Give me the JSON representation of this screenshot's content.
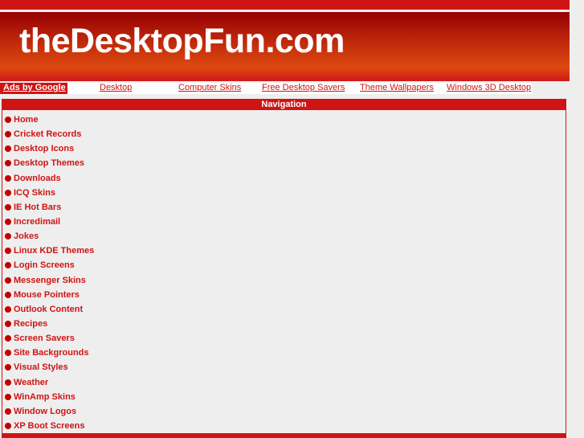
{
  "site_title": "theDesktopFun.com",
  "links": {
    "ads": "Ads by Google",
    "items": [
      "Desktop",
      "Computer Skins",
      "Free Desktop Savers",
      "Theme Wallpapers",
      "Windows 3D Desktop"
    ]
  },
  "nav": {
    "heading": "Navigation",
    "items": [
      "Home",
      "Cricket Records",
      "Desktop Icons",
      "Desktop Themes",
      "Downloads",
      "ICQ Skins",
      "IE Hot Bars",
      "Incredimail",
      "Jokes",
      "Linux KDE Themes",
      "Login Screens",
      "Messenger Skins",
      "Mouse Pointers",
      "Outlook Content",
      "Recipes",
      "Screen Savers",
      "Site Backgrounds",
      "Visual Styles",
      "Weather",
      "WinAmp Skins",
      "Window Logos",
      "XP Boot Screens"
    ]
  }
}
